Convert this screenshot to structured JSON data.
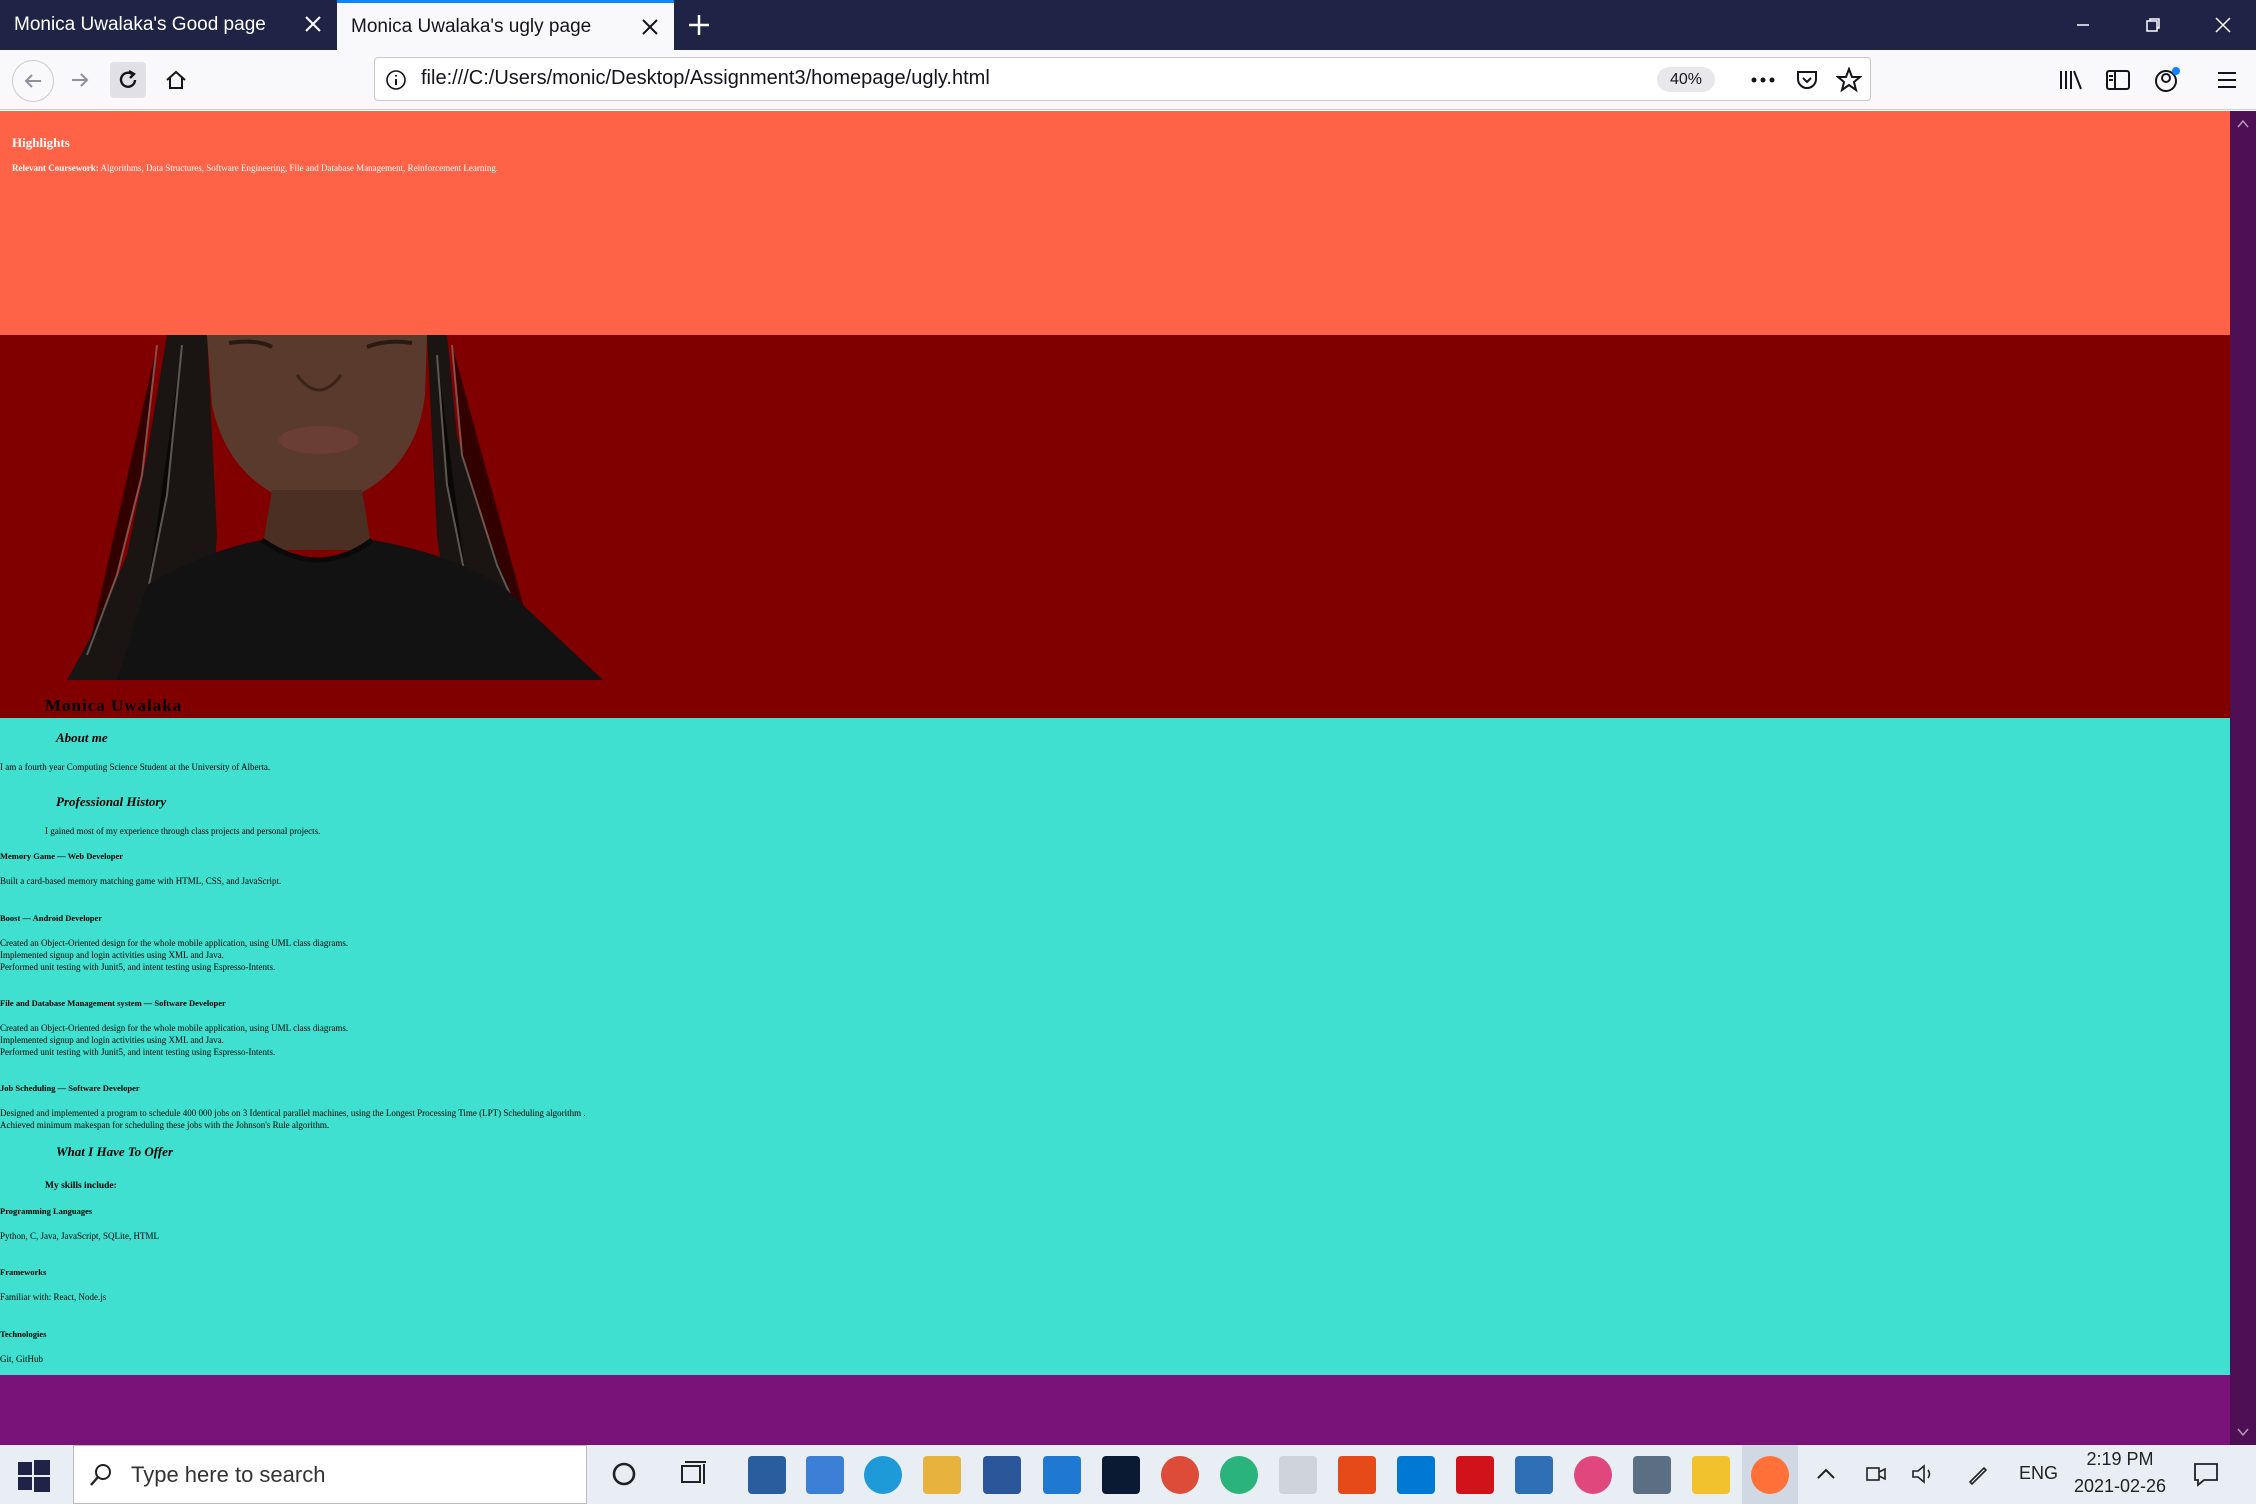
{
  "browser": {
    "tabs": [
      {
        "label": "Monica Uwalaka's Good page"
      },
      {
        "label": "Monica Uwalaka's ugly page"
      }
    ],
    "url": "file:///C:/Users/monic/Desktop/Assignment3/homepage/ugly.html",
    "zoom": "40%"
  },
  "page": {
    "highlights": {
      "heading": "Highlights",
      "coursework_label": "Relevant Coursework:",
      "coursework_text": " Algorithms, Data Structures, Software Engineering, File and Database Management, Reinforcement Learning."
    },
    "name": "Monica Uwalaka",
    "about": {
      "heading": "About me",
      "text": "I am a fourth year Computing Science Student at the University of Alberta."
    },
    "history": {
      "heading": "Professional History",
      "intro": "I gained most of my experience through class projects and personal projects.",
      "jobs": [
        {
          "title": "Memory Game — Web Developer",
          "lines": [
            "Built a card-based memory matching game with HTML, CSS, and JavaScript."
          ]
        },
        {
          "title": "Boost — Android Developer",
          "lines": [
            "Created an Object-Oriented design for the whole mobile application, using UML class diagrams.",
            "Implemented signup and login activities using XML and Java.",
            "Performed unit testing with Junit5, and intent testing using Espresso-Intents."
          ]
        },
        {
          "title": "File and Database Management system — Software Developer",
          "lines": [
            "Created an Object-Oriented design for the whole mobile application, using UML class diagrams.",
            "Implemented signup and login activities using XML and Java.",
            "Performed unit testing with Junit5, and intent testing using Espresso-Intents."
          ]
        },
        {
          "title": "Job Scheduling — Software Developer",
          "lines": [
            "Designed and implemented a program to schedule 400 000 jobs on 3 Identical parallel machines, using the Longest Processing Time (LPT) Scheduling algorithm .",
            "Achieved minimum makespan for scheduling these jobs with the Johnson's Rule algorithm."
          ]
        }
      ]
    },
    "offer": {
      "heading": "What I Have To Offer",
      "skills_intro": "My skills include:",
      "skills": [
        {
          "title": "Programming Languages",
          "text": "Python, C, Java, JavaScript, SQLite, HTML"
        },
        {
          "title": "Frameworks",
          "text": "Familiar with: React, Node.js"
        },
        {
          "title": "Technologies",
          "text": "Git, GitHub"
        }
      ]
    }
  },
  "taskbar": {
    "search_placeholder": "Type here to search",
    "language": "ENG",
    "time": "2:19 PM",
    "date": "2021-02-26"
  },
  "colors": {
    "highlights_bg": "#ff6347",
    "hero_bg": "#800000",
    "content_bg": "#40e0d0",
    "page_bg": "#79137a"
  }
}
